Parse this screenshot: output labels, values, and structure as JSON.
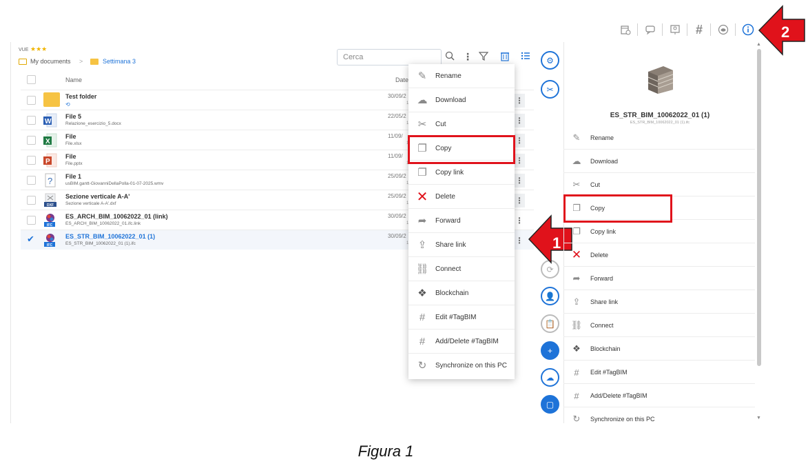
{
  "top_toolbar": {
    "icons": [
      "calendar-building-icon",
      "comment-edit-icon",
      "presentation-icon",
      "hashtag-icon",
      "cloud-eye-icon",
      "info-icon"
    ]
  },
  "callouts": {
    "arrow1_number": "1",
    "arrow2_number": "2"
  },
  "panel": {
    "vue_label": "VUE",
    "stars": "★★★",
    "breadcrumb": {
      "root": "My documents",
      "separator": ">",
      "current": "Settimana 3"
    },
    "search_placeholder": "Cerca",
    "columns": {
      "name": "Name",
      "date": "Date"
    }
  },
  "files": [
    {
      "name": "Test folder",
      "sub": "",
      "date": "30/09/2",
      "date2": "1",
      "type": "folder",
      "selected": false
    },
    {
      "name": "File 5",
      "sub": "Relazione_esercizio_5.docx",
      "date": "22/05/2",
      "date2": "1",
      "type": "word",
      "selected": false
    },
    {
      "name": "File",
      "sub": "File.xlsx",
      "date": "11/09/",
      "date2": "1",
      "type": "excel",
      "selected": false
    },
    {
      "name": "File",
      "sub": "File.pptx",
      "date": "11/09/",
      "date2": "1",
      "type": "powerpoint",
      "selected": false
    },
    {
      "name": "File 1",
      "sub": "usBIM.gantt-GiovanniDellaPolla-01-07-2025.wmv",
      "date": "25/09/2",
      "date2": "1",
      "type": "unknown",
      "selected": false
    },
    {
      "name": "Sezione verticale A-A'",
      "sub": "Sezione verticale A-A'.dxf",
      "date": "25/09/2",
      "date2": "1",
      "type": "dxf",
      "selected": false
    },
    {
      "name": "ES_ARCH_BIM_10062022_01 (link)",
      "sub": "ES_ARCH_BIM_10062022_01.ifc.link",
      "date": "30/09/2",
      "date2": "1",
      "type": "ifc-link",
      "selected": false
    },
    {
      "name": "ES_STR_BIM_10062022_01 (1)",
      "sub": "ES_STR_BIM_10062022_01 (1).ifc",
      "date": "30/09/2",
      "date2": "1",
      "type": "ifc",
      "selected": true
    }
  ],
  "context_menu": {
    "items": [
      {
        "label": "Rename",
        "icon": "pencil-icon"
      },
      {
        "label": "Download",
        "icon": "cloud-download-icon"
      },
      {
        "label": "Cut",
        "icon": "scissors-icon"
      },
      {
        "label": "Copy",
        "icon": "copy-icon"
      },
      {
        "label": "Copy link",
        "icon": "copy-link-icon"
      },
      {
        "label": "Delete",
        "icon": "delete-x-icon"
      },
      {
        "label": "Forward",
        "icon": "forward-arrow-icon"
      },
      {
        "label": "Share link",
        "icon": "share-icon"
      },
      {
        "label": "Connect",
        "icon": "link-chain-icon"
      },
      {
        "label": "Blockchain",
        "icon": "blockchain-icon"
      },
      {
        "label": "Edit #TagBIM",
        "icon": "hashtag-edit-icon"
      },
      {
        "label": "Add/Delete #TagBIM",
        "icon": "hashtag-add-icon"
      },
      {
        "label": "Synchronize on this PC",
        "icon": "sync-icon"
      }
    ]
  },
  "right_panel": {
    "title": "ES_STR_BIM_10062022_01 (1)",
    "subtitle": "ES_STR_BIM_10062022_01 (1).ifc",
    "items": [
      {
        "label": "Rename",
        "icon": "pencil-icon"
      },
      {
        "label": "Download",
        "icon": "cloud-download-icon"
      },
      {
        "label": "Cut",
        "icon": "scissors-icon"
      },
      {
        "label": "Copy",
        "icon": "copy-icon"
      },
      {
        "label": "Copy link",
        "icon": "copy-link-icon"
      },
      {
        "label": "Delete",
        "icon": "delete-x-icon"
      },
      {
        "label": "Forward",
        "icon": "forward-arrow-icon"
      },
      {
        "label": "Share link",
        "icon": "share-icon"
      },
      {
        "label": "Connect",
        "icon": "link-chain-icon"
      },
      {
        "label": "Blockchain",
        "icon": "blockchain-icon"
      },
      {
        "label": "Edit #TagBIM",
        "icon": "hashtag-edit-icon"
      },
      {
        "label": "Add/Delete #TagBIM",
        "icon": "hashtag-add-icon"
      },
      {
        "label": "Synchronize on this PC",
        "icon": "sync-icon"
      }
    ]
  },
  "caption": "Figura 1",
  "colors": {
    "accent": "#1e73d8",
    "highlight": "#e0121b",
    "folder": "#f6c343"
  }
}
